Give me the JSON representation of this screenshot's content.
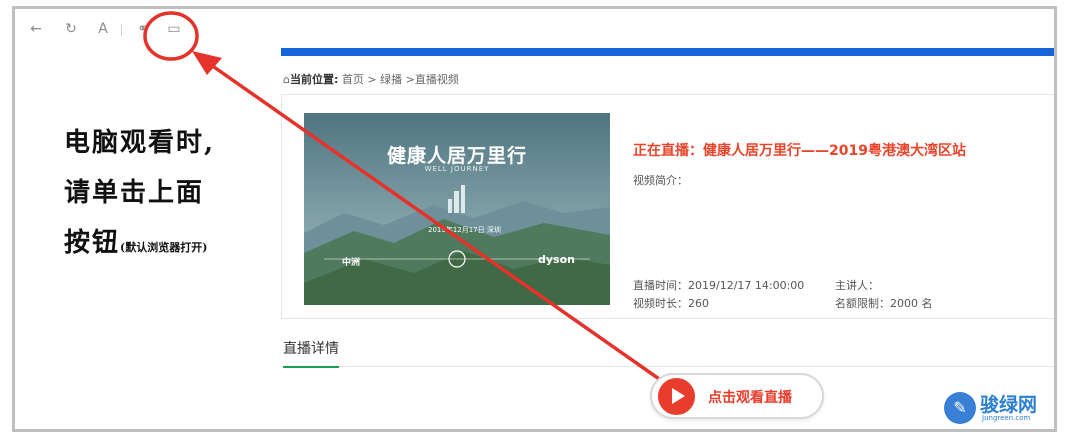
{
  "toolbar": {
    "back_icon": "←",
    "refresh_icon": "↻",
    "font_icon": "A",
    "link_icon": "⚭",
    "window_icon": "▭"
  },
  "breadcrumb": {
    "home_icon": "⌂",
    "label": "当前位置:",
    "path": "首页 > 绿播 >直播视频"
  },
  "thumbnail": {
    "title": "健康人居万里行",
    "subtitle": "WELL JOURNEY",
    "date": "2019年12月17日 深圳",
    "sponsor_left": "中洲",
    "sponsor_right": "dyson"
  },
  "live": {
    "title": "正在直播：健康人居万里行——2019粤港澳大湾区站",
    "intro_label": "视频简介：",
    "time_label": "直播时间：",
    "time_value": "2019/12/17 14:00:00",
    "speaker_label": "主讲人：",
    "speaker_value": "",
    "duration_label": "视频时长：",
    "duration_value": "260",
    "quota_label": "名额限制：",
    "quota_value": "2000 名"
  },
  "tabs": {
    "detail": "直播详情"
  },
  "annotation": {
    "line1": "电脑观看时,",
    "line2": "请单击上面",
    "line3": "按钮",
    "line3_small": "(默认浏览器打开)"
  },
  "watch_button": {
    "label": "点击观看直播"
  },
  "watermark": {
    "name": "骏绿网",
    "url": "Jungreen.com"
  },
  "colors": {
    "accent_red": "#e8452c",
    "blue_bar": "#1565d8",
    "tab_green": "#1aa154"
  }
}
